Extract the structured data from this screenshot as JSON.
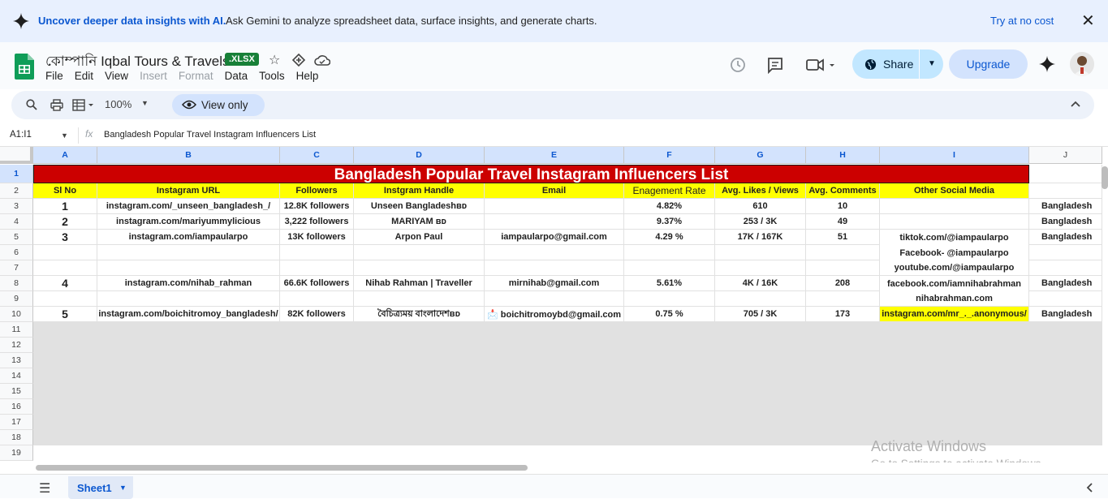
{
  "banner": {
    "headline": "Uncover deeper data insights with AI.",
    "text": "Ask Gemini to analyze spreadsheet data, surface insights, and generate charts.",
    "cta": "Try at no cost",
    "close": "✕"
  },
  "doc": {
    "title": "কোম্পানি Iqbal Tours & Travels",
    "badge": ".XLSX",
    "menu": [
      "File",
      "Edit",
      "View",
      "Insert",
      "Format",
      "Data",
      "Tools",
      "Help"
    ]
  },
  "header": {
    "share": "Share",
    "upgrade": "Upgrade"
  },
  "toolbar": {
    "zoom": "100%",
    "view_only": "View only"
  },
  "formula_bar": {
    "name_box": "A1:I1",
    "fx": "fx",
    "value": "Bangladesh Popular Travel Instagram Influencers List"
  },
  "columns": [
    "A",
    "B",
    "C",
    "D",
    "E",
    "F",
    "G",
    "H",
    "I",
    "J"
  ],
  "rows": [
    "1",
    "2",
    "3",
    "4",
    "5",
    "6",
    "7",
    "8",
    "9",
    "10",
    "11",
    "12",
    "13",
    "14",
    "15",
    "16",
    "17",
    "18",
    "19"
  ],
  "sheet": {
    "title": "Bangladesh Popular Travel Instagram Influencers List",
    "headers": [
      "Sl No",
      "Instagram URL",
      "Followers",
      "Instgram Handle",
      "Email",
      "Enagement Rate",
      "Avg. Likes / Views",
      "Avg. Comments",
      "Other Social Media"
    ],
    "r3": [
      "1",
      "instagram.com/_unseen_bangladesh_/",
      "12.8K followers",
      "Unseen Bangladeshʙᴅ",
      "",
      "4.82%",
      "610",
      "10",
      "",
      "Bangladesh"
    ],
    "r4": [
      "2",
      "instagram.com/mariyummylicious",
      "3,222 followers",
      "MARIYAM ʙᴅ",
      "",
      "9.37%",
      "253 / 3K",
      "49",
      "",
      "Bangladesh"
    ],
    "r5": [
      "3",
      "instagram.com/iampaularpo",
      "13K followers",
      "Arpon Paul",
      "iampaularpo@gmail.com",
      "4.29 %",
      "17K / 167K",
      "51",
      "tiktok.com/@iampaularpo",
      "Bangladesh"
    ],
    "r6_i": "Facebook- @iampaularpo",
    "r7_i": "youtube.com/@iampaularpo",
    "r8": [
      "4",
      "instagram.com/nihab_rahman",
      "66.6K followers",
      "Nihab Rahman | Traveller",
      "mirnihab@gmail.com",
      "5.61%",
      "4K / 16K",
      "208",
      "facebook.com/iamnihabrahman",
      "Bangladesh"
    ],
    "r9_i": "nihabrahman.com",
    "r10": [
      "5",
      "instagram.com/boichitromoy_bangladesh/",
      "82K followers",
      "বৈচিত্র্যময় বাংলাদেশʙᴅ",
      "📩 boichitromoybd@gmail.com",
      "0.75 %",
      "705 / 3K",
      "173",
      "instagram.com/mr_._.anonymous/",
      "Bangladesh"
    ]
  },
  "sheet_tab": "Sheet1",
  "watermark": {
    "line1": "Activate Windows",
    "line2": "Go to Settings to activate Windows."
  }
}
